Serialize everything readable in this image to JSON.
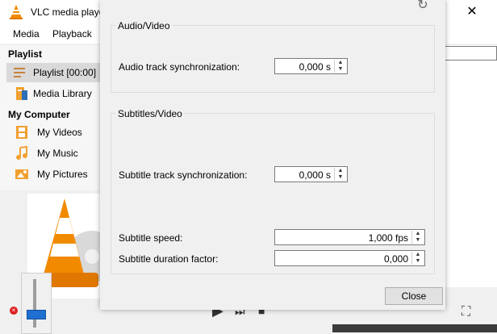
{
  "vlc": {
    "title": "VLC media playe",
    "close_glyph": "✕",
    "menu": [
      "Media",
      "Playback"
    ],
    "sidebar": {
      "playlist_header": "Playlist",
      "items_playlist": [
        {
          "label": "Playlist [00:00]",
          "icon": "playlist-icon",
          "selected": true
        },
        {
          "label": "Media Library",
          "icon": "media-library-icon",
          "selected": false
        }
      ],
      "computer_header": "My Computer",
      "items_computer": [
        {
          "label": "My Videos",
          "icon": "videos-icon"
        },
        {
          "label": "My Music",
          "icon": "music-icon"
        },
        {
          "label": "My Pictures",
          "icon": "pictures-icon"
        }
      ]
    },
    "controls": {
      "play": "▶",
      "next": "⏭",
      "stop": "■",
      "fullscreen": "⛶"
    },
    "accent": "#1f6fd0"
  },
  "dialog": {
    "refresh_glyph": "↻",
    "audio_video": {
      "title": "Audio/Video",
      "audio_sync_label": "Audio track synchronization:",
      "audio_sync_value": "0,000 s"
    },
    "subtitles_video": {
      "title": "Subtitles/Video",
      "subtitle_sync_label": "Subtitle track synchronization:",
      "subtitle_sync_value": "0,000 s",
      "subtitle_speed_label": "Subtitle speed:",
      "subtitle_speed_value": "1,000 fps",
      "subtitle_duration_label": "Subtitle duration factor:",
      "subtitle_duration_value": "0,000"
    },
    "close_label": "Close"
  }
}
